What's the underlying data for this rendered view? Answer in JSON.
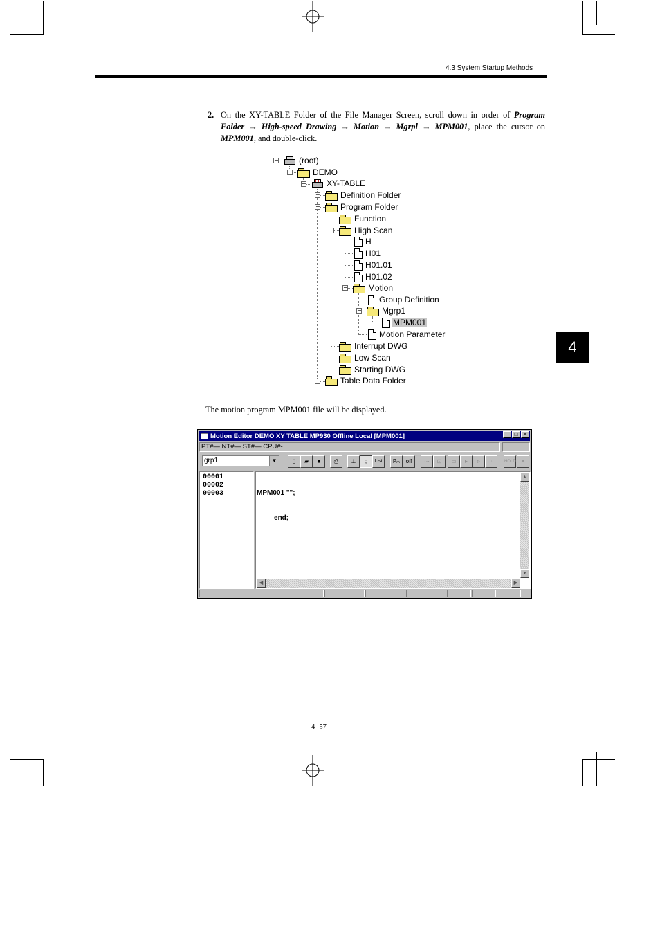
{
  "header": {
    "section": "4.3  System Startup Methods"
  },
  "chapter_tab": "4",
  "step": {
    "number": "2.",
    "text_before": "On the XY-TABLE Folder of the File Manager Screen, scroll down in order of ",
    "path_1": "Program Folder",
    "arrow": " → ",
    "path_2": "High-speed Drawing",
    "path_3": "Motion",
    "path_4": "Mgrpl",
    "path_5": "MPM001",
    "text_mid": ", place the cursor on ",
    "target": "MPM001",
    "text_after": ", and double-click."
  },
  "tree": {
    "root": "(root)",
    "demo": "DEMO",
    "xytable": "XY-TABLE",
    "definition_folder": "Definition Folder",
    "program_folder": "Program Folder",
    "function": "Function",
    "high_scan": "High Scan",
    "h": "H",
    "h01": "H01",
    "h0101": "H01.01",
    "h0102": "H01.02",
    "motion": "Motion",
    "group_definition": "Group Definition",
    "mgrp1": "Mgrp1",
    "mpm001": "MPM001",
    "motion_parameter": "Motion Parameter",
    "interrupt_dwg": "Interrupt DWG",
    "low_scan": "Low Scan",
    "starting_dwg": "Starting DWG",
    "table_data_folder": "Table Data Folder"
  },
  "caption": "The motion program MPM001 file will be displayed.",
  "window": {
    "title": "Motion Editor  DEMO  XY TABLE  MP930     Offline  Local  [MPM001]",
    "status": "PT#— NT#— ST#— CPU#-",
    "group_select": "grp1",
    "toolbar": {
      "list_label": "List",
      "semicolon": ";",
      "pm_label": "Pₘ",
      "off_label": "off",
      "hold_label": "HOLD"
    },
    "line_numbers": [
      "00001",
      "00002",
      "00003"
    ],
    "code_lines": [
      "MPM001 \"\";",
      "         end;"
    ]
  },
  "page_number": "4 -57"
}
